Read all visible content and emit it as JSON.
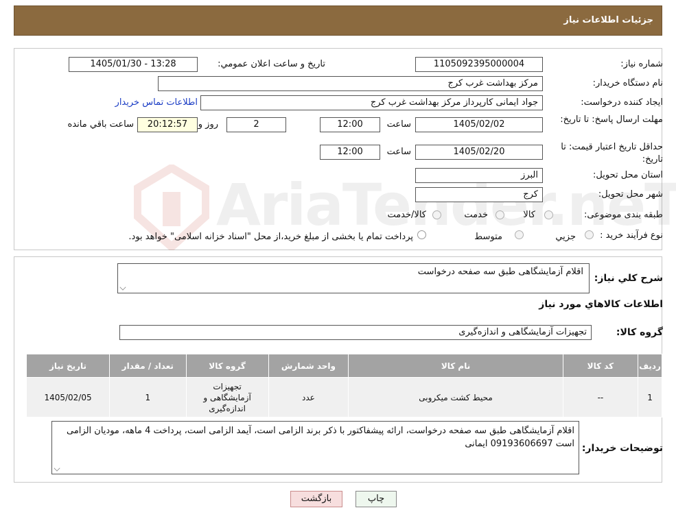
{
  "header": {
    "title": "جزئیات اطلاعات نیاز"
  },
  "watermark": {
    "text": "AriaTender.neT"
  },
  "form": {
    "need_number_label": "شماره نیاز:",
    "need_number": "1105092395000004",
    "announce_label": "تاریخ و ساعت اعلان عمومي:",
    "announce_value": "1405/01/30 - 13:28",
    "buyer_org_label": "نام دستگاه خریدار:",
    "buyer_org": "مرکز بهداشت غرب کرج",
    "creator_label": "ایجاد کننده درخواست:",
    "creator": "جواد ایمانی کارپرداز مرکز بهداشت غرب کرج",
    "contact_link": "اطلاعات تماس خریدار",
    "deadline_label": "مهلت ارسال پاسخ: تا تاریخ:",
    "deadline_date": "1405/02/02",
    "time_label": "ساعت",
    "deadline_time": "12:00",
    "days_value": "2",
    "days_label": "روز و",
    "remaining_value": "20:12:57",
    "remaining_label": "ساعت باقي مانده",
    "validity_label": "حداقل تاریخ اعتبار قیمت: تا تاریخ:",
    "validity_date": "1405/02/20",
    "validity_time": "12:00",
    "province_label": "استان محل تحویل:",
    "province": "البرز",
    "city_label": "شهر محل تحویل:",
    "city": "کرج",
    "category_label": "طبقه بندی موضوعی:",
    "category_options": [
      "کالا",
      "خدمت",
      "کالا/خدمت"
    ],
    "purchase_type_label": "نوع فرآیند خرید :",
    "purchase_options": [
      "جزيي",
      "متوسط"
    ],
    "purchase_note": "پرداخت تمام یا بخشی از مبلغ خرید،از محل \"اسناد خزانه اسلامی\" خواهد بود."
  },
  "details": {
    "summary_label": "شرح کلي نياز:",
    "summary": "اقلام آزمایشگاهی طبق سه صفحه درخواست",
    "goods_info_title": "اطلاعات کالاهاي مورد نياز",
    "goods_group_label": "گروه کالا:",
    "goods_group": "تجهیزات آزمایشگاهی و اندازه‌گیری",
    "table": {
      "headers": [
        "رديف",
        "کد کالا",
        "نام کالا",
        "واحد شمارش",
        "گروه کالا",
        "تعداد / مقدار",
        "تاریخ نیاز"
      ],
      "rows": [
        {
          "row": "1",
          "code": "--",
          "name": "محیط کشت میکروبی",
          "unit": "عدد",
          "group": "تجهیزات آزمایشگاهی و اندازه‌گیری",
          "qty": "1",
          "date": "1405/02/05"
        }
      ]
    },
    "buyer_notes_label": "توضیحات خریدار:",
    "buyer_notes": "اقلام آزمایشگاهی طبق سه صفحه درخواست، ارائه پیشفاکتور با ذکر برند الزامی است، آیمد الزامی است، پرداخت 4 ماهه، مودیان الزامی است 09193606697 ایمانی"
  },
  "buttons": {
    "print": "چاپ",
    "back": "بازگشت"
  }
}
